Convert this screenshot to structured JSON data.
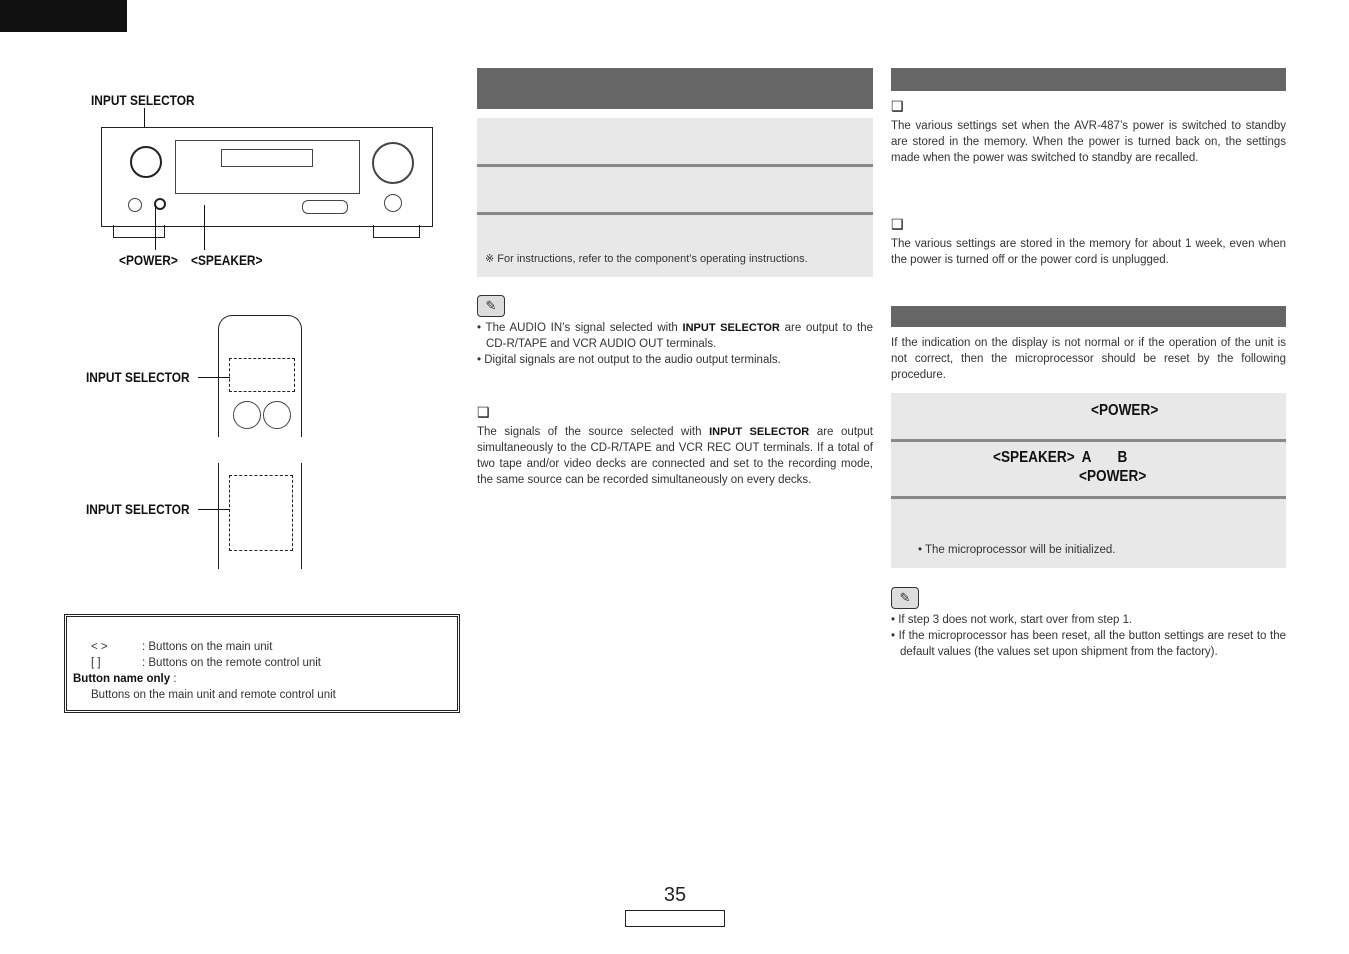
{
  "labels": {
    "input_selector": "INPUT SELECTOR",
    "power": "<POWER>",
    "speaker": "<SPEAKER>"
  },
  "legend": {
    "angle": "<      >",
    "angle_desc": ": Buttons on the main unit",
    "bracket": "[       ]",
    "bracket_desc": ": Buttons on the remote control unit",
    "name_only": "Button name only",
    "name_only_colon": " :",
    "name_only_desc": "Buttons on the main unit and remote control unit"
  },
  "middle": {
    "footnote": "※ For instructions, refer to the component’s operating instructions.",
    "notes": [
      "• The AUDIO IN’s signal selected with ",
      "INPUT SELECTOR",
      " are output to the CD-R/TAPE and VCR AUDIO OUT terminals.",
      "• Digital signals are not output to the audio output terminals."
    ],
    "section_icon": "❑",
    "rec_pre": "The signals of the source selected with ",
    "rec_bold": "INPUT SELECTOR",
    "rec_post": " are output simultaneously to the CD-R/TAPE and VCR REC OUT terminals. If a total of two tape and/or video decks are connected and set to the recording mode, the same source can be recorded simultaneously on every decks."
  },
  "right": {
    "icon": "❑",
    "p1": "The various settings set when the AVR-487’s power is switched to standby are stored in the memory. When the power is turned back on, the settings made when the power was switched to standby are recalled.",
    "p2": "The various settings are stored in the memory for about 1 week, even when the power is turned off or the power cord is unplugged.",
    "p3": "If the indication on the display is not normal or if the operation of the unit is not correct, then the microprocessor should be reset by the following procedure.",
    "step1": "<POWER>",
    "step2a": "<SPEAKER>  A       B",
    "step2b": "<POWER>",
    "step3": "• The microprocessor will be initialized.",
    "notes": [
      "• If step 3 does not work, start over from step 1.",
      "• If the microprocessor has been reset, all the button settings are reset to the default values (the values set upon shipment from the factory)."
    ]
  },
  "page_number": "35"
}
